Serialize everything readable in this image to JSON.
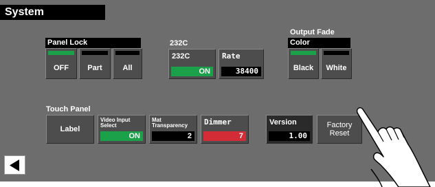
{
  "title": "System",
  "panel_lock": {
    "header": "Panel Lock",
    "buttons": [
      {
        "label": "OFF",
        "active": true
      },
      {
        "label": "Part",
        "active": false
      },
      {
        "label": "All",
        "active": false
      }
    ]
  },
  "rs232c": {
    "label": "232C",
    "toggle": {
      "label": "232C",
      "value": "ON"
    },
    "rate": {
      "label": "Rate",
      "value": "38400"
    }
  },
  "output_fade": {
    "label": "Output Fade",
    "header": "Color",
    "buttons": [
      {
        "label": "Black",
        "active": true
      },
      {
        "label": "White",
        "active": false
      }
    ]
  },
  "touch_panel": {
    "label": "Touch Panel",
    "label_button": "Label",
    "video_input_select": {
      "label_line1": "Video Input",
      "label_line2": "Select",
      "value": "ON"
    },
    "mat_transparency": {
      "label_line1": "Mat",
      "label_line2": "Transparency",
      "value": "2"
    },
    "dimmer": {
      "label": "Dimmer",
      "value": "7"
    }
  },
  "version": {
    "label": "Version",
    "value": "1.00"
  },
  "factory_reset": {
    "line1": "Factory",
    "line2": "Reset"
  },
  "colors": {
    "active_green": "#1aa14a",
    "dimmer_red": "#d42c36",
    "screen_bg": "#6d6d6d"
  },
  "icons": {
    "back": "back-arrow-icon",
    "hand": "pointing-hand-icon"
  }
}
